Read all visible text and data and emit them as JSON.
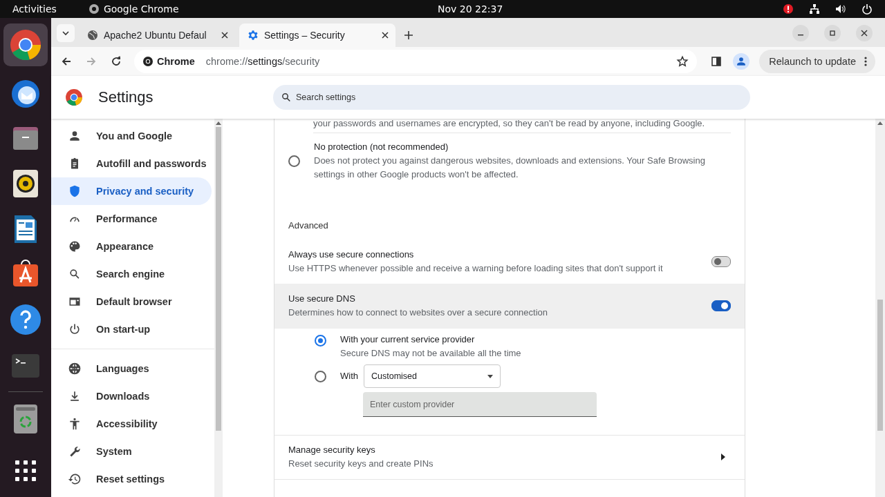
{
  "top_bar": {
    "activities": "Activities",
    "app_name": "Google Chrome",
    "clock": "Nov 20  22:37"
  },
  "tabs": [
    {
      "title": "Apache2 Ubuntu Defaul",
      "selected": false
    },
    {
      "title": "Settings – Security",
      "selected": true
    }
  ],
  "address_bar": {
    "chip": "Chrome",
    "url_scheme": "chrome://",
    "url_host": "settings",
    "url_path": "/security"
  },
  "relaunch_button": "Relaunch to update",
  "settings_header": {
    "title": "Settings",
    "search_placeholder": "Search settings"
  },
  "sidebar": {
    "groups": [
      [
        {
          "label": "You and Google",
          "selected": false
        },
        {
          "label": "Autofill and passwords",
          "selected": false
        },
        {
          "label": "Privacy and security",
          "selected": true
        },
        {
          "label": "Performance",
          "selected": false
        },
        {
          "label": "Appearance",
          "selected": false
        },
        {
          "label": "Search engine",
          "selected": false
        },
        {
          "label": "Default browser",
          "selected": false
        },
        {
          "label": "On start-up",
          "selected": false
        }
      ],
      [
        {
          "label": "Languages",
          "selected": false
        },
        {
          "label": "Downloads",
          "selected": false
        },
        {
          "label": "Accessibility",
          "selected": false
        },
        {
          "label": "System",
          "selected": false
        },
        {
          "label": "Reset settings",
          "selected": false
        }
      ]
    ]
  },
  "content": {
    "clipped_text": "your passwords and usernames are encrypted, so they can't be read by anyone, including Google.",
    "no_protection": {
      "title": "No protection (not recommended)",
      "description": "Does not protect you against dangerous websites, downloads and extensions. Your Safe Browsing settings in other Google products won't be affected.",
      "selected": false
    },
    "advanced_heading": "Advanced",
    "toggle_rows": [
      {
        "title": "Always use secure connections",
        "description": "Use HTTPS whenever possible and receive a warning before loading sites that don't support it",
        "on": false,
        "highlighted": false
      },
      {
        "title": "Use secure DNS",
        "description": "Determines how to connect to websites over a secure connection",
        "on": true,
        "highlighted": true
      }
    ],
    "dns_options": [
      {
        "kind": "plain",
        "label": "With your current service provider",
        "description": "Secure DNS may not be available all the time",
        "selected": true
      },
      {
        "kind": "custom",
        "label": "With",
        "dropdown_value": "Customised",
        "placeholder": "Enter custom provider",
        "selected": false
      }
    ],
    "manage_keys": {
      "title": "Manage security keys",
      "description": "Reset security keys and create PINs"
    }
  }
}
